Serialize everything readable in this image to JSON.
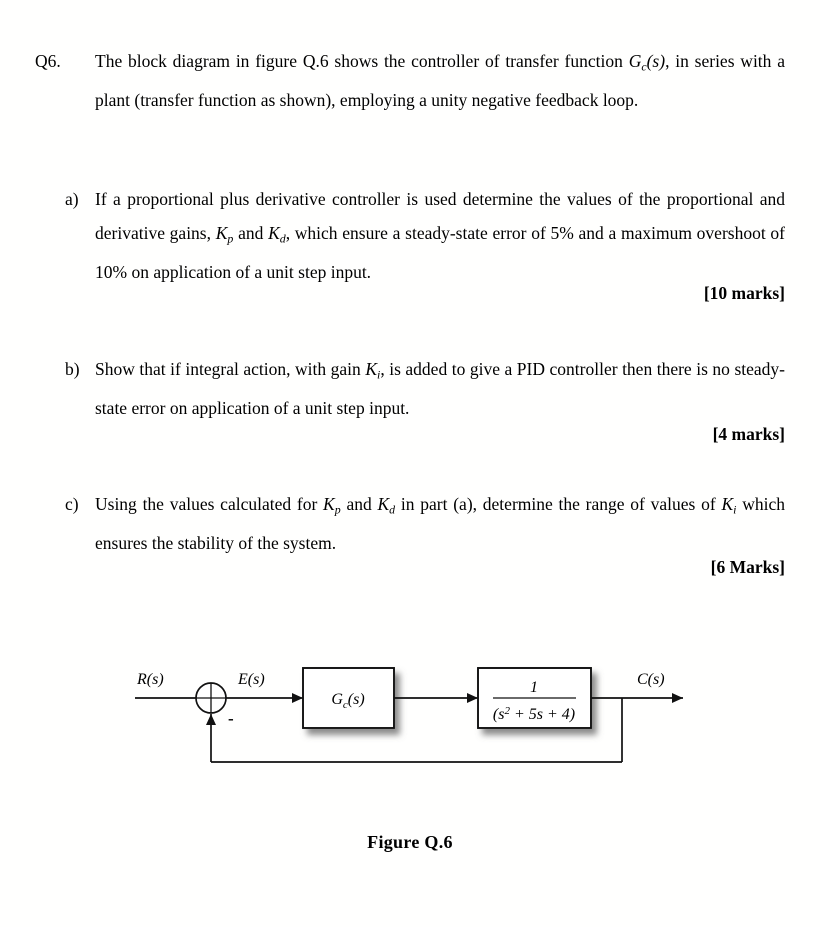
{
  "document": {
    "question_number": "Q6.",
    "intro": {
      "text_before_gc": "The block diagram in figure Q.6 shows the controller of transfer function ",
      "gc_symbol": "G",
      "gc_subscript": "c",
      "gc_arg": "(s)",
      "text_after_gc": ", in series with a plant (transfer function as shown), employing a unity negative feedback loop."
    },
    "parts": [
      {
        "label": "a)",
        "segments": [
          {
            "type": "text",
            "value": "If a proportional plus derivative controller is used determine the values of the proportional and derivative gains, "
          },
          {
            "type": "var",
            "base": "K",
            "sub": "p"
          },
          {
            "type": "text",
            "value": " and "
          },
          {
            "type": "var",
            "base": "K",
            "sub": "d"
          },
          {
            "type": "text",
            "value": ", which ensure a steady-state error of 5% and a maximum overshoot of 10% on application of a unit step input."
          }
        ],
        "marks": "[10 marks]"
      },
      {
        "label": "b)",
        "segments": [
          {
            "type": "text",
            "value": "Show that if integral action, with gain "
          },
          {
            "type": "var",
            "base": "K",
            "sub": "i"
          },
          {
            "type": "text",
            "value": ", is added to give a PID controller then there is no steady-state error on application of a unit step input."
          }
        ],
        "marks": "[4 marks]"
      },
      {
        "label": "c)",
        "segments": [
          {
            "type": "text",
            "value": "Using the values calculated for "
          },
          {
            "type": "var",
            "base": "K",
            "sub": "p"
          },
          {
            "type": "text",
            "value": " and "
          },
          {
            "type": "var",
            "base": "K",
            "sub": "d"
          },
          {
            "type": "text",
            "value": " in part (a), determine the range of values of "
          },
          {
            "type": "var",
            "base": "K",
            "sub": "i"
          },
          {
            "type": "text",
            "value": " which ensures the stability of the system."
          }
        ],
        "marks": "[6 Marks]"
      }
    ]
  },
  "figure": {
    "caption": "Figure Q.6",
    "input_label": {
      "base": "R",
      "arg": "(s)"
    },
    "error_label": {
      "base": "E",
      "arg": "(s)"
    },
    "output_label": {
      "base": "C",
      "arg": "(s)"
    },
    "summing_junction": {
      "type": "circle-cross",
      "feedback_sign": "-"
    },
    "controller_block": {
      "base": "G",
      "sub": "c",
      "arg": "(s)"
    },
    "plant_block": {
      "numerator": "1",
      "denominator_open": "(",
      "denominator_s": "s",
      "denominator_pow": "2",
      "denominator_rest": " + 5s + 4)"
    },
    "feedback_path": "unity negative feedback",
    "colors": {
      "line": "#000000",
      "block_fill": "#ffffff",
      "block_border": "#000000",
      "shadow": "#9a9a9a",
      "page_background": "#ffffff"
    }
  }
}
